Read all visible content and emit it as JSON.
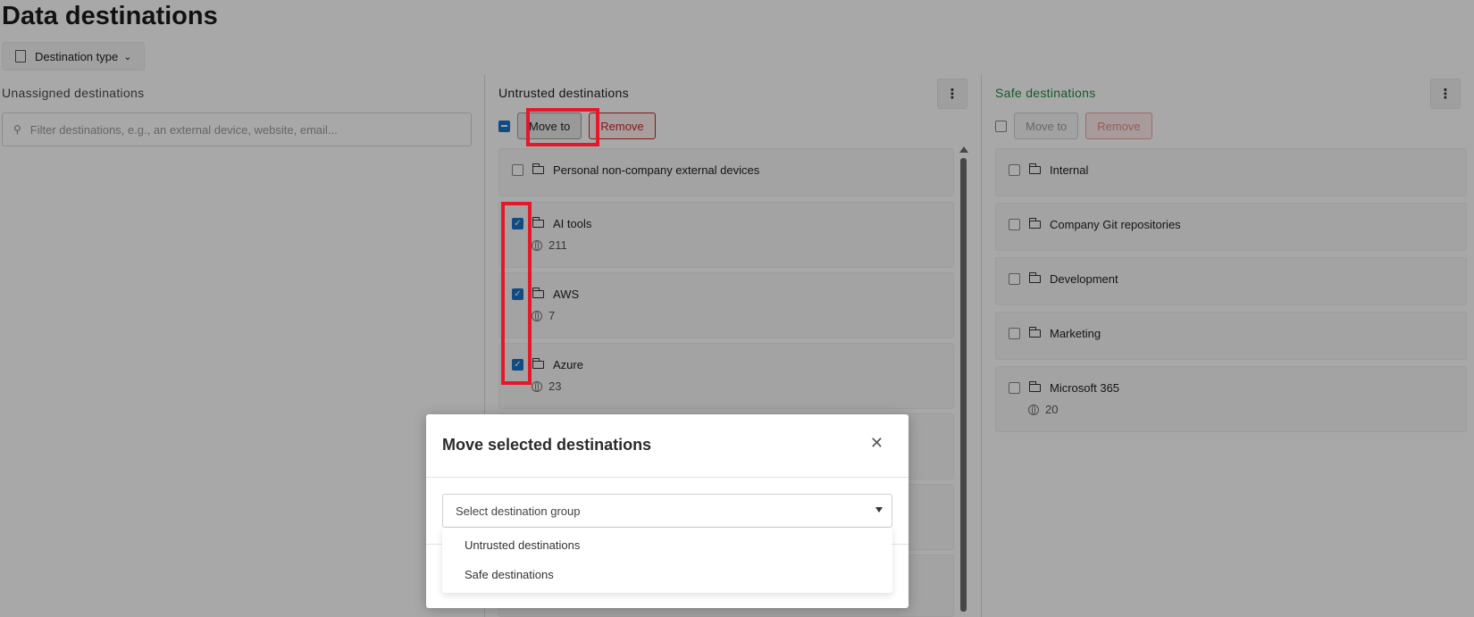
{
  "page": {
    "title": "Data destinations"
  },
  "filters": {
    "destination_type_label": "Destination type"
  },
  "unassigned": {
    "header": "Unassigned destinations",
    "search_placeholder": "Filter destinations, e.g., an external device, website, email..."
  },
  "untrusted": {
    "header": "Untrusted destinations",
    "move_label": "Move to",
    "remove_label": "Remove",
    "items": [
      {
        "name": "Personal non-company external devices",
        "count": "",
        "checked": false
      },
      {
        "name": "AI tools",
        "count": "211",
        "checked": true
      },
      {
        "name": "AWS",
        "count": "7",
        "checked": true
      },
      {
        "name": "Azure",
        "count": "23",
        "checked": true
      }
    ]
  },
  "safe": {
    "header": "Safe destinations",
    "move_label": "Move to",
    "remove_label": "Remove",
    "items": [
      {
        "name": "Internal",
        "count": ""
      },
      {
        "name": "Company Git repositories",
        "count": ""
      },
      {
        "name": "Development",
        "count": ""
      },
      {
        "name": "Marketing",
        "count": ""
      },
      {
        "name": "Microsoft 365",
        "count": "20"
      }
    ]
  },
  "modal": {
    "title": "Move selected destinations",
    "select_placeholder": "Select destination group",
    "options": [
      "Untrusted destinations",
      "Safe destinations"
    ]
  },
  "colors": {
    "accent": "#1772c9",
    "safe": "#218a3f",
    "danger": "#c62828",
    "highlight": "#e3182b"
  }
}
